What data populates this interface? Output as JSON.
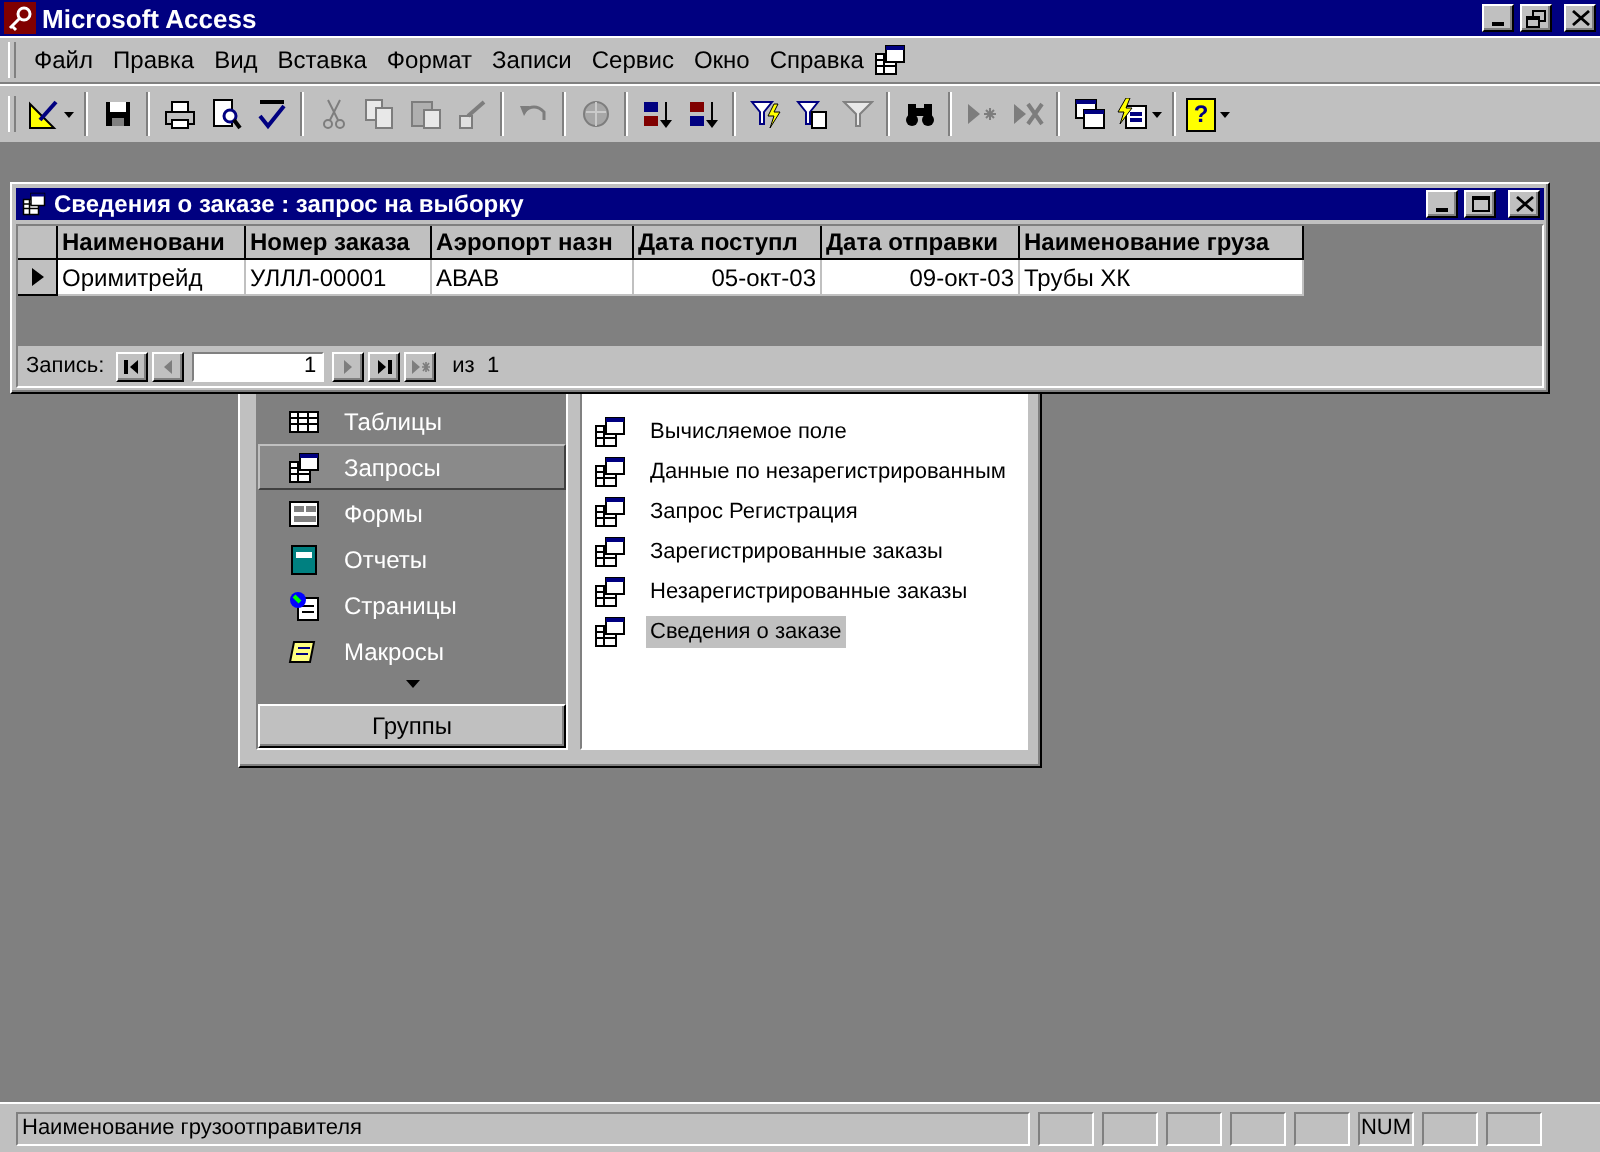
{
  "app": {
    "title": "Microsoft Access"
  },
  "menu": [
    {
      "label": "Файл"
    },
    {
      "label": "Правка"
    },
    {
      "label": "Вид"
    },
    {
      "label": "Вставка"
    },
    {
      "label": "Формат"
    },
    {
      "label": "Записи"
    },
    {
      "label": "Сервис"
    },
    {
      "label": "Окно"
    },
    {
      "label": "Справка"
    }
  ],
  "toolbar": [
    {
      "kind": "view",
      "disabled": false,
      "dropdown": true
    },
    {
      "kind": "separator"
    },
    {
      "kind": "save",
      "disabled": false
    },
    {
      "kind": "separator"
    },
    {
      "kind": "print",
      "disabled": false
    },
    {
      "kind": "preview",
      "disabled": false
    },
    {
      "kind": "spelling",
      "disabled": false
    },
    {
      "kind": "separator"
    },
    {
      "kind": "cut",
      "disabled": true
    },
    {
      "kind": "copy",
      "disabled": true
    },
    {
      "kind": "paste",
      "disabled": true
    },
    {
      "kind": "painter",
      "disabled": true
    },
    {
      "kind": "separator"
    },
    {
      "kind": "undo",
      "disabled": true
    },
    {
      "kind": "separator"
    },
    {
      "kind": "web",
      "disabled": true
    },
    {
      "kind": "separator"
    },
    {
      "kind": "sort_asc",
      "disabled": false
    },
    {
      "kind": "sort_desc",
      "disabled": false
    },
    {
      "kind": "separator"
    },
    {
      "kind": "filter_selection",
      "disabled": false
    },
    {
      "kind": "filter_form",
      "disabled": false
    },
    {
      "kind": "apply_filter",
      "disabled": true
    },
    {
      "kind": "separator"
    },
    {
      "kind": "find",
      "disabled": false
    },
    {
      "kind": "separator"
    },
    {
      "kind": "new_record",
      "disabled": true
    },
    {
      "kind": "delete_record",
      "disabled": true
    },
    {
      "kind": "separator"
    },
    {
      "kind": "db_window",
      "disabled": false
    },
    {
      "kind": "new_object",
      "disabled": false,
      "dropdown": true
    },
    {
      "kind": "separator"
    },
    {
      "kind": "help",
      "glyph": "?",
      "disabled": false,
      "dropdown": true
    }
  ],
  "query_window": {
    "title": "Сведения о заказе : запрос на выборку",
    "columns": [
      {
        "label": "Наименовани",
        "numeric": false
      },
      {
        "label": "Номер заказа",
        "numeric": false
      },
      {
        "label": "Аэропорт назн",
        "numeric": false
      },
      {
        "label": "Дата поступл",
        "numeric": true
      },
      {
        "label": "Дата отправки",
        "numeric": true
      },
      {
        "label": "Наименование груза",
        "numeric": false
      }
    ],
    "rows": [
      {
        "current": true,
        "cells": [
          "Оримитрейд",
          "УЛЛЛ-00001",
          "АВАВ",
          "05-окт-03",
          "09-окт-03",
          "Трубы ХК"
        ]
      }
    ],
    "navigator": {
      "label": "Запись:",
      "value": "1",
      "total": "из  1",
      "buttons": [
        {
          "kind": "first",
          "disabled": false
        },
        {
          "kind": "prev",
          "disabled": true
        },
        {
          "kind": "next",
          "disabled": true
        },
        {
          "kind": "last",
          "disabled": false
        },
        {
          "kind": "new",
          "disabled": true
        }
      ]
    }
  },
  "database_window": {
    "groups": [
      {
        "label": "Таблицы",
        "kind": "tables",
        "selected": false
      },
      {
        "label": "Запросы",
        "kind": "queries",
        "selected": true
      },
      {
        "label": "Формы",
        "kind": "forms",
        "selected": false
      },
      {
        "label": "Отчеты",
        "kind": "reports",
        "selected": false
      },
      {
        "label": "Страницы",
        "kind": "pages",
        "selected": false
      },
      {
        "label": "Макросы",
        "kind": "macros",
        "selected": false
      }
    ],
    "groups_button": "Группы",
    "objects": [
      {
        "label": "Вычисляемое поле",
        "kind": "query",
        "selected": false
      },
      {
        "label": "Данные по незарегистрированным",
        "kind": "query",
        "selected": false
      },
      {
        "label": "Запрос Регистрация",
        "kind": "query",
        "selected": false
      },
      {
        "label": "Зарегистрированные заказы",
        "kind": "query",
        "selected": false
      },
      {
        "label": "Незарегистрированные заказы",
        "kind": "query",
        "selected": false
      },
      {
        "label": "Сведения о заказе",
        "kind": "query",
        "selected": true
      }
    ]
  },
  "status_bar": {
    "text": "Наименование грузоотправителя",
    "indicators": [
      {
        "kind": "blank"
      },
      {
        "kind": "blank"
      },
      {
        "kind": "blank"
      },
      {
        "kind": "blank"
      },
      {
        "kind": "blank"
      },
      {
        "kind": "text",
        "label": "NUM"
      },
      {
        "kind": "blank"
      },
      {
        "kind": "blank"
      }
    ]
  }
}
